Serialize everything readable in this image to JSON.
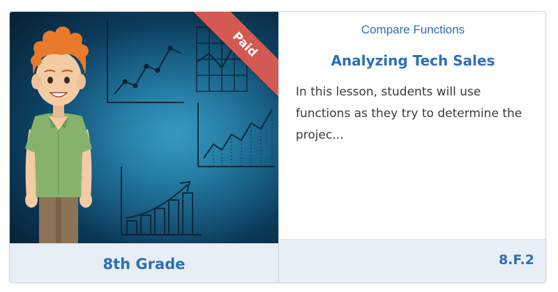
{
  "card": {
    "badge": "Paid",
    "grade": "8th Grade",
    "topic": "Compare Functions",
    "title": "Analyzing Tech Sales",
    "description": "In this lesson, students will use functions as they try to determine the projec...",
    "standard": "8.F.2"
  },
  "colors": {
    "accent": "#2c6fb6",
    "badge": "#d35a52",
    "footer_bg": "#e8eef5",
    "thumbnail_bg": "#135a80"
  },
  "icons": {
    "illustration": "student-with-graphs-illustration"
  }
}
